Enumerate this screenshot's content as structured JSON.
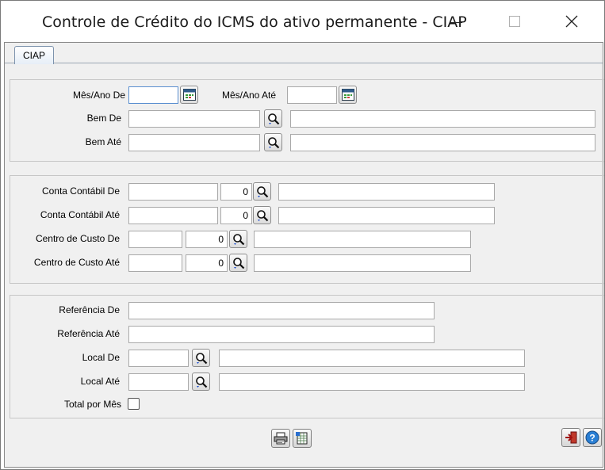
{
  "window": {
    "title": "Controle de Crédito do ICMS do ativo permanente - CIAP"
  },
  "tabs": [
    {
      "label": "CIAP"
    }
  ],
  "group1": {
    "mes_ano_de": {
      "label": "Mês/Ano De",
      "value": ""
    },
    "mes_ano_ate": {
      "label": "Mês/Ano Até",
      "value": ""
    },
    "bem_de": {
      "label": "Bem De",
      "value": "",
      "desc": ""
    },
    "bem_ate": {
      "label": "Bem Até",
      "value": "",
      "desc": ""
    }
  },
  "group2": {
    "conta_de": {
      "label": "Conta Contábil De",
      "value": "",
      "num": "0",
      "desc": ""
    },
    "conta_ate": {
      "label": "Conta Contábil Até",
      "value": "",
      "num": "0",
      "desc": ""
    },
    "centro_de": {
      "label": "Centro de Custo De",
      "value": "",
      "num": "0",
      "desc": ""
    },
    "centro_ate": {
      "label": "Centro de Custo Até",
      "value": "",
      "num": "0",
      "desc": ""
    }
  },
  "group3": {
    "referencia_de": {
      "label": "Referência De",
      "value": ""
    },
    "referencia_ate": {
      "label": "Referência Até",
      "value": ""
    },
    "local_de": {
      "label": "Local De",
      "value": "",
      "desc": ""
    },
    "local_ate": {
      "label": "Local Até",
      "value": "",
      "desc": ""
    },
    "total_por_mes": {
      "label": "Total por Mês",
      "checked": false
    }
  },
  "icons": {
    "calendar": "calendar-icon",
    "search": "magnifier-icon",
    "print": "printer-icon",
    "export": "spreadsheet-export-icon",
    "exit": "exit-icon",
    "help": "help-icon"
  },
  "colors": {
    "tab_border": "#7d93ad",
    "help_blue": "#2a7fd4",
    "exit_red": "#c0392b"
  }
}
